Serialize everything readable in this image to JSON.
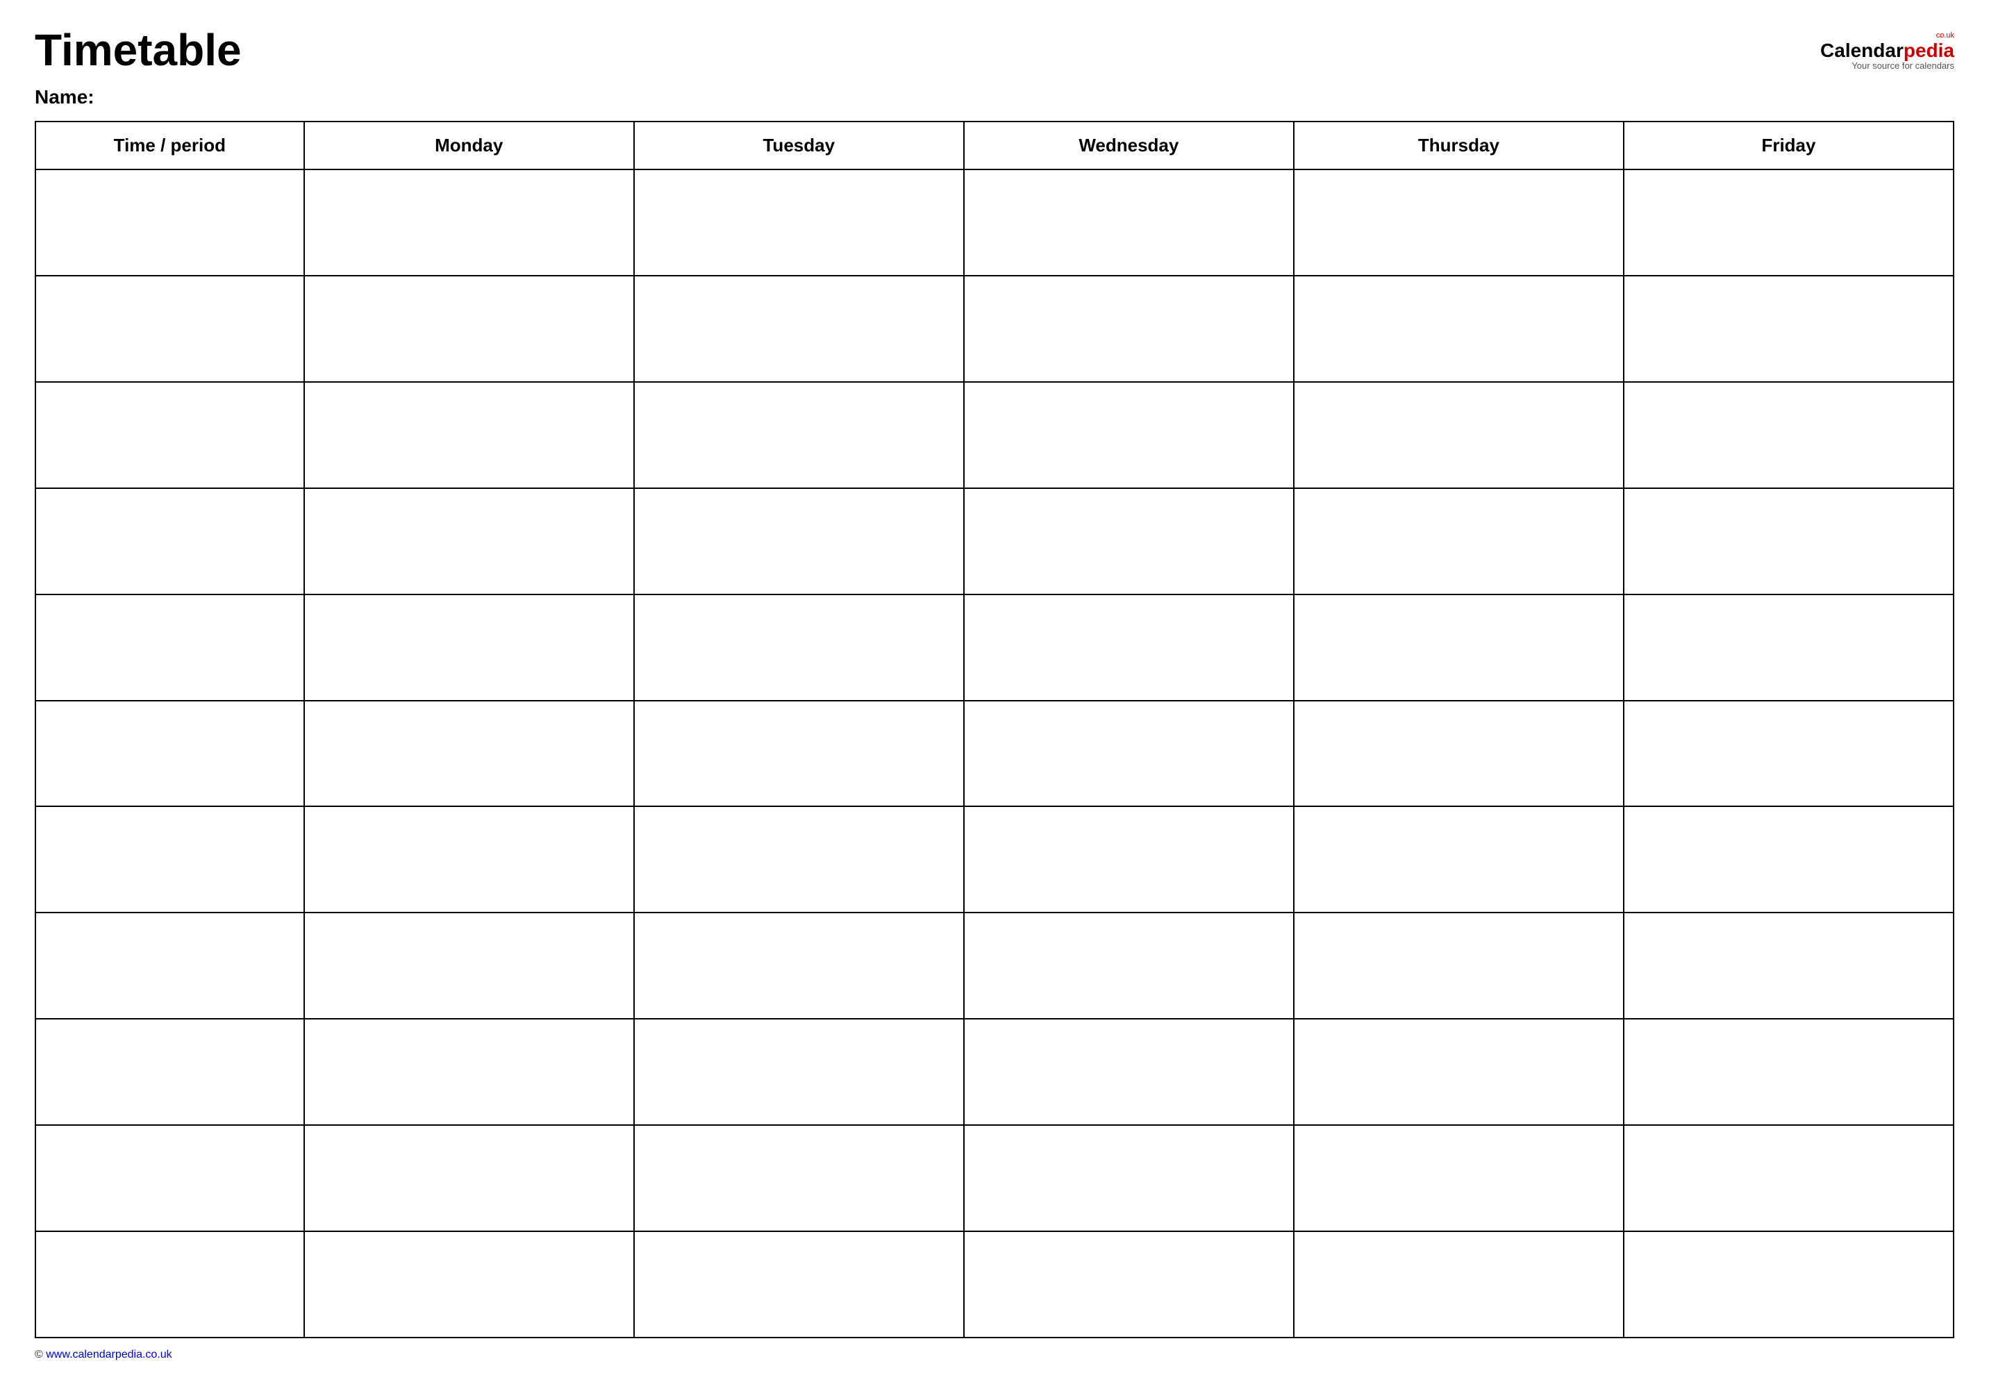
{
  "header": {
    "title": "Timetable",
    "logo": {
      "calendar": "Calendar",
      "pedia": "pedia",
      "couk": "co.uk",
      "tagline": "Your source for calendars"
    }
  },
  "name_label": "Name:",
  "table": {
    "columns": [
      "Time / period",
      "Monday",
      "Tuesday",
      "Wednesday",
      "Thursday",
      "Friday"
    ],
    "row_count": 11
  },
  "footer": {
    "url": "www.calendarpedia.co.uk"
  }
}
